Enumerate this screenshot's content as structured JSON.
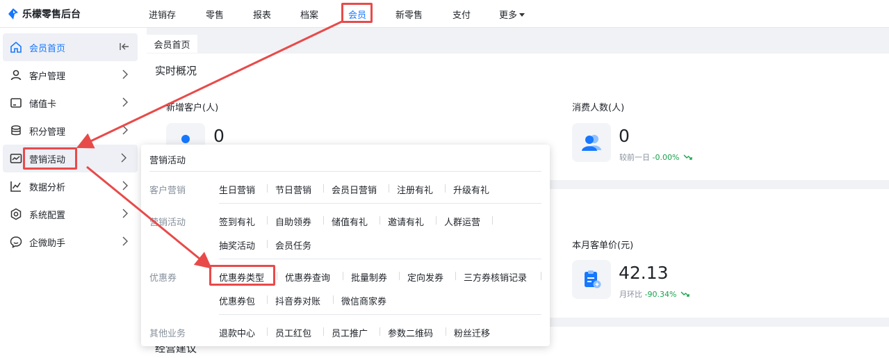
{
  "app": {
    "title": "乐檬零售后台"
  },
  "topnav": [
    {
      "label": "进销存"
    },
    {
      "label": "零售"
    },
    {
      "label": "报表"
    },
    {
      "label": "档案"
    },
    {
      "label": "会员"
    },
    {
      "label": "新零售"
    },
    {
      "label": "支付"
    },
    {
      "label": "更多"
    }
  ],
  "sidebar": {
    "items": [
      {
        "label": "会员首页",
        "icon": "home-icon"
      },
      {
        "label": "客户管理",
        "icon": "user-icon"
      },
      {
        "label": "储值卡",
        "icon": "card-icon"
      },
      {
        "label": "积分管理",
        "icon": "coins-icon"
      },
      {
        "label": "营销活动",
        "icon": "monitor-chart-icon"
      },
      {
        "label": "数据分析",
        "icon": "line-chart-icon"
      },
      {
        "label": "系统配置",
        "icon": "hexagon-settings-icon"
      },
      {
        "label": "企微助手",
        "icon": "chat-icon"
      }
    ]
  },
  "page": {
    "tab": "会员首页",
    "overview_title": "实时概况",
    "stats": {
      "new_customers": {
        "label": "新增客户(人)",
        "value": "0"
      },
      "consumers": {
        "label": "消费人数(人)",
        "value": "0",
        "compare_label": "较前一日",
        "compare_value": "-0.00%"
      },
      "unit_price": {
        "label": "本月客单价(元)",
        "value": "42.13",
        "compare_label": "月环比",
        "compare_value": "-90.34%"
      }
    },
    "partial_heading": "经营建议"
  },
  "popup": {
    "title": "营销活动",
    "groups": [
      {
        "label": "客户营销",
        "links": [
          "生日营销",
          "节日营销",
          "会员日营销",
          "注册有礼",
          "升级有礼"
        ]
      },
      {
        "label": "营销活动",
        "links": [
          "签到有礼",
          "自助领券",
          "储值有礼",
          "邀请有礼",
          "人群运营",
          "抽奖活动",
          "会员任务"
        ]
      },
      {
        "label": "优惠券",
        "links": [
          "优惠券类型",
          "优惠券查询",
          "批量制券",
          "定向发券",
          "三方券核销记录",
          "优惠券包",
          "抖音券对账",
          "微信商家券"
        ]
      },
      {
        "label": "其他业务",
        "links": [
          "退款中心",
          "员工红包",
          "员工推广",
          "参数二维码",
          "粉丝迁移"
        ]
      }
    ]
  },
  "colors": {
    "accent": "#1677ff",
    "annotation": "#e84a4a",
    "positive": "#16a34a"
  }
}
